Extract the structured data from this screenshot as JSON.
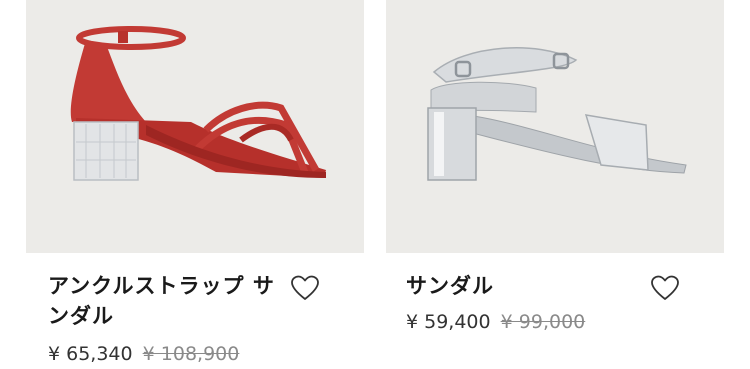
{
  "products": [
    {
      "name": "アンクルストラップ サンダル",
      "price": "¥ 65,340",
      "original_price": "¥ 108,900",
      "color": "#c23a34",
      "image_alt": "red-ankle-strap-sandal"
    },
    {
      "name": "サンダル",
      "price": "¥ 59,400",
      "original_price": "¥ 99,000",
      "color": "#d8dadd",
      "image_alt": "silver-sandal"
    }
  ],
  "icons": {
    "favorite": "heart-outline-icon"
  },
  "colors": {
    "image_bg": "#ecebe8",
    "text": "#1a1a1a",
    "price_old": "#8a8a8a"
  }
}
